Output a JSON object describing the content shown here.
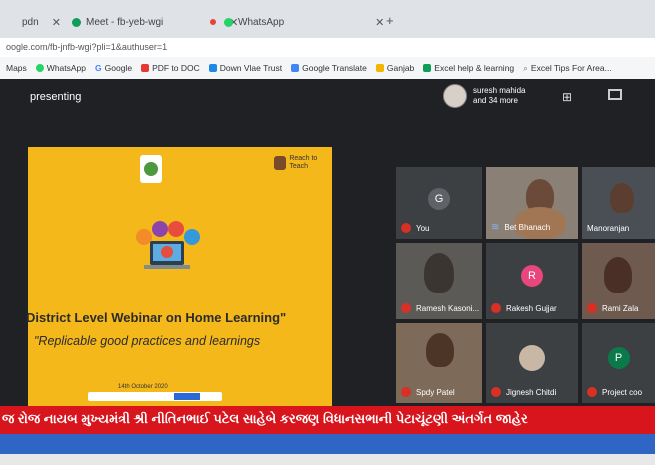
{
  "browser": {
    "tabs": [
      {
        "label": "pdn",
        "color": "#f2a900"
      },
      {
        "label": "Meet - fb-yeb-wgi",
        "color": "#0f9d58"
      },
      {
        "label": "WhatsApp",
        "color": "#25d366"
      }
    ],
    "address": "oogle.com/fb-jnfb-wgi?pli=1&authuser=1",
    "bookmarks": [
      {
        "label": "Maps",
        "color": "#4caf50"
      },
      {
        "label": "WhatsApp",
        "color": "#25d366"
      },
      {
        "label": "Google",
        "color": "#4285f4"
      },
      {
        "label": "PDF to DOC",
        "color": "#e53935"
      },
      {
        "label": "Down Vlae Trust",
        "color": "#1e88e5"
      },
      {
        "label": "Google Translate",
        "color": "#4285f4"
      },
      {
        "label": "Ganjab",
        "color": "#f4b400"
      },
      {
        "label": "Excel help & learning",
        "color": "#0f9d58"
      },
      {
        "label": "Excel Tips For Area...",
        "color": "#777777"
      }
    ]
  },
  "meet": {
    "presenting_label": "presenting",
    "participants_line1": "suresh mahida",
    "participants_line2": "and 34 more",
    "slide": {
      "rtt_text": "Reach to Teach",
      "title": "District Level Webinar on Home Learning\"",
      "subtitle": "\"Replicable good practices and learnings",
      "date": "14th October 2020"
    },
    "tiles": [
      {
        "name": "You",
        "initial": "G",
        "avatar_color": "#5f6368"
      },
      {
        "name": "Bet Bhanach",
        "initial": "",
        "avatar_color": ""
      },
      {
        "name": "Manoranjan",
        "initial": "",
        "avatar_color": ""
      },
      {
        "name": "Ramesh Kasoni...",
        "initial": "",
        "avatar_color": ""
      },
      {
        "name": "Rakesh Gujjar",
        "initial": "R",
        "avatar_color": "#e8467c"
      },
      {
        "name": "Rami Zala",
        "initial": "",
        "avatar_color": ""
      },
      {
        "name": "Spdy Patel",
        "initial": "",
        "avatar_color": ""
      },
      {
        "name": "Jignesh Chitdi",
        "initial": "",
        "avatar_color": ""
      },
      {
        "name": "Project coo",
        "initial": "P",
        "avatar_color": "#0b7a4b"
      }
    ]
  },
  "ticker": "જ રોજ નાયબ મુખ્યમંત્રી શ્રી નીતિનભાઈ પટેલ સાહેબે કરજણ વિધાનસભાની પેટાચૂંટણી અંતર્ગત જાહેર"
}
